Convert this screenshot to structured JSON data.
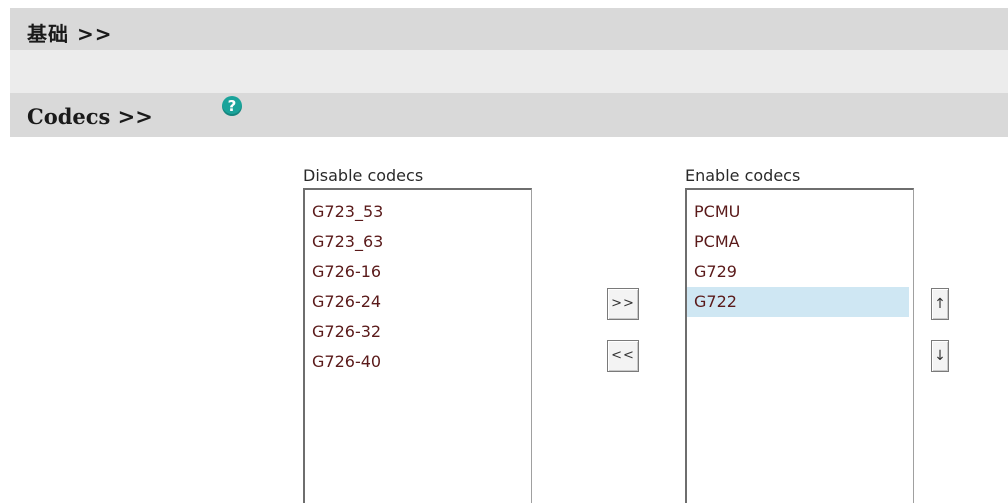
{
  "sections": {
    "basic": {
      "title": "基础 >>"
    },
    "codecs": {
      "title": "Codecs >>",
      "help_icon": "?"
    }
  },
  "codec_lists": {
    "disabled": {
      "label": "Disable codecs",
      "items": [
        "G723_53",
        "G723_63",
        "G726-16",
        "G726-24",
        "G726-32",
        "G726-40"
      ]
    },
    "enabled": {
      "label": "Enable codecs",
      "items": [
        "PCMU",
        "PCMA",
        "G729",
        "G722"
      ],
      "selected": "G722"
    }
  },
  "buttons": {
    "move_right": ">>",
    "move_left": "<<",
    "move_up": "↑",
    "move_down": "↓"
  },
  "colors": {
    "section_bar": "#d9d9d9",
    "help_icon": "#1aa39a",
    "selected_row": "#cfe7f3"
  }
}
